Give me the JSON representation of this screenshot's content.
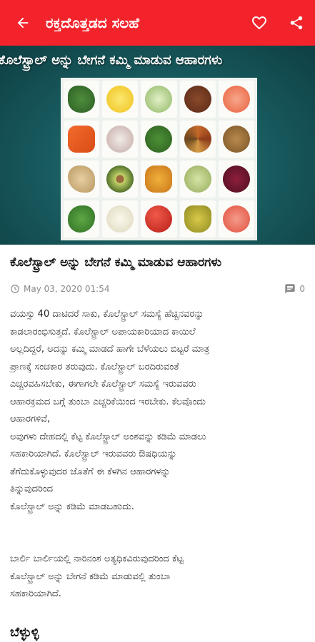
{
  "appbar": {
    "title": "ರಕ್ತದೊತ್ತಡದ ಸಲಹೆ",
    "background": "#f2232b",
    "icons": [
      "back-arrow-icon",
      "heart-icon",
      "share-icon"
    ]
  },
  "hero": {
    "title": "ಕೊಲೆಸ್ಟ್ರಾಲ್ ಅನ್ನು ಬೇಗನೆ ಕಮ್ಮಿ ಮಾಡುವ ಆಹಾರಗಳು",
    "foods": [
      "spinach",
      "lemon",
      "cabbage",
      "flax-seeds",
      "grapefruit",
      "carrots",
      "garlic",
      "broccoli",
      "spices",
      "walnuts",
      "ginger",
      "avocado",
      "turmeric",
      "green-tea",
      "beetroot",
      "parsley",
      "cauliflower",
      "apple",
      "olive-oil",
      "grapefruit-halves"
    ]
  },
  "article": {
    "headline": "ಕೊಲೆಸ್ಟ್ರಾಲ್ ಅನ್ನು ಬೇಗನೆ ಕಮ್ಮಿ ಮಾಡುವ ಆಹಾರಗಳು",
    "date": "May 03, 2020 01:54",
    "comments": "0",
    "paragraph1": [
      "ವಯಸ್ಸು 40 ದಾಟಿದರೆ ಸಾಕು, ಕೊಲೆಸ್ಟ್ರಾಲ್ ಸಮಸ್ಯೆ ಹೆಚ್ಚಿನವರನ್ನು",
      "ಕಾಡಲಾರಂಭಿಸುತ್ತದೆ. ಕೊಲೆಸ್ಟ್ರಾಲ್ ಅಪಾಯಕಾರಿಯಾದ ಕಾಯಿಲೆ",
      "ಅಲ್ಲದಿದ್ದರೆ, ಅದನ್ನು ಕಮ್ಮಿ ಮಾಡದೆ ಹಾಗೇ ಬೆಳೆಯಲು ಬಿಟ್ಟರೆ ಮಾತ್ರ",
      "ಪ್ರಾಣಕ್ಕೆ ಸಂಚಕಾರ ತರುವುದು. ಕೊಲೆಸ್ಟ್ರಾಲ್ ಬರದಿರುವಂತೆ",
      "ಎಚ್ಚರವಹಿಸಬೇಕು, ಈಗಾಗಲೇ ಕೊಲೆಸ್ಟ್ರಾಲ್ ಸಮಸ್ಯೆ ಇರುವವರು",
      "ಆಹಾರಕ್ರಮದ ಬಗ್ಗೆ ತುಂಬಾ ಎಚ್ಚರಿಕೆಯಿಂದ ಇರಬೇಕು. ಕೆಲವೊಂದು",
      "ಆಹಾರಗಳಿವೆ,",
      "ಅವುಗಳು ದೇಹದಲ್ಲಿ ಕೆಟ್ಟ ಕೊಲೆಸ್ಟ್ರಾಲ್ ಅಂಶವನ್ನು ಕಡಿಮೆ ಮಾಡಲು",
      "ಸಹಕಾರಿಯಾಗಿದೆ. ಕೊಲೆಸ್ಟ್ರಾಲ್ ಇರುವವರು ಔಷಧಿಯನ್ನು",
      "ತೆಗೆದುಕೊಳ್ಳುವುದರ ಜೊತೆಗೆ ಈ ಕೆಳಗಿನ ಆಹಾರಗಳನ್ನು",
      "ತಿನ್ನುವುದರಿಂದ",
      "ಕೊಲೆಸ್ಟ್ರಾಲ್ ಅನ್ನು ಕಡಿಮೆ ಮಾಡಬಹುದು."
    ],
    "paragraph2": [
      "ಬಾರ್ಲಿ ಬಾರ್ಲಿಯಲ್ಲಿ ನಾರಿನಂಶ ಅತ್ಯಧಿಕವಿರುವುದರಿಂದ ಕೆಟ್ಟ",
      "ಕೊಲೆಸ್ಟ್ರಾಲ್ ಅನ್ನು ಬೇಗನೆ ಕಡಿಮೆ ಮಾಡುವಲ್ಲಿ ತುಂಬಾ",
      "ಸಹಕಾರಿಯಾಗಿದೆ."
    ],
    "next_heading": "ಬೆಳ್ಳುಳ್ಳಿ"
  }
}
